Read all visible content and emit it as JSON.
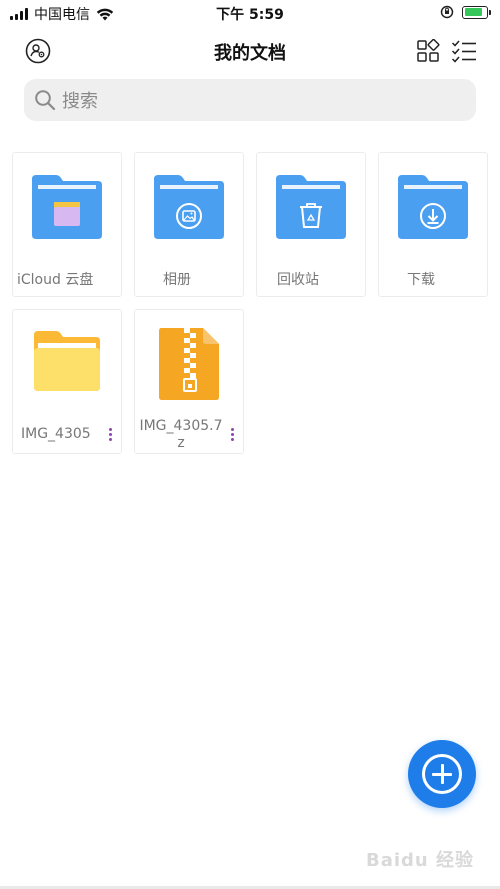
{
  "status_bar": {
    "carrier": "中国电信",
    "time": "下午 5:59",
    "battery_level": 0.85
  },
  "header": {
    "title": "我的文档",
    "avatar_icon": "profile-settings-icon",
    "grid_view_icon": "grid-view-icon",
    "list_view_icon": "checklist-icon"
  },
  "search": {
    "placeholder": "搜索"
  },
  "items": [
    {
      "label": "iCloud 云盘",
      "icon": "icloud-folder-icon"
    },
    {
      "label": "相册",
      "icon": "album-folder-icon"
    },
    {
      "label": "回收站",
      "icon": "recycle-bin-folder-icon"
    },
    {
      "label": "下载",
      "icon": "download-folder-icon"
    },
    {
      "label": "IMG_4305",
      "icon": "yellow-folder-icon"
    },
    {
      "label": "IMG_4305.7z",
      "icon": "zip-archive-icon"
    }
  ],
  "fab": {
    "icon": "add-icon"
  },
  "watermark": "Baidu 经验",
  "colors": {
    "folder_blue": "#4a9ff0",
    "folder_yellow": "#fdd652",
    "zip_orange": "#f5a623",
    "fab_blue": "#1e7de8",
    "more_purple": "#8e44ad"
  }
}
